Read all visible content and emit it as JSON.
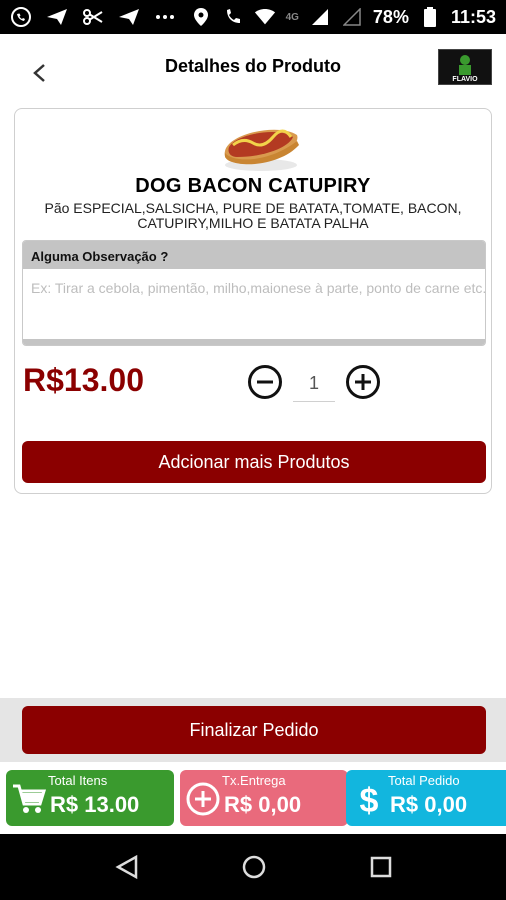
{
  "status_bar": {
    "network": "4G",
    "battery": "78%",
    "time": "11:53"
  },
  "header": {
    "title": "Detalhes do Produto",
    "logo_text": "FLAVIO"
  },
  "product": {
    "name": "DOG BACON CATUPIRY",
    "description": "Pão ESPECIAL,SALSICHA, PURE DE BATATA,TOMATE, BACON, CATUPIRY,MILHO E BATATA PALHA",
    "price": "R$13.00"
  },
  "observation": {
    "label": "Alguma Observação ?",
    "placeholder": "Ex: Tirar a cebola, pimentão, milho,maionese à parte, ponto de carne etc."
  },
  "quantity": {
    "value": "1"
  },
  "buttons": {
    "add_more": "Adcionar mais Produtos",
    "finalize": "Finalizar Pedido"
  },
  "totals": {
    "items_label": "Total Itens",
    "items_value": "R$ 13.00",
    "fee_label": "Tx.Entrega",
    "fee_value": "R$ 0,00",
    "order_label": "Total Pedido",
    "order_value": "R$ 0,00"
  },
  "colors": {
    "brand": "#8b0000",
    "items_green": "#3a9a2e",
    "fee_pink": "#e96a7c",
    "order_cyan": "#12b6de"
  },
  "icons": [
    "whatsapp-icon",
    "send-icon",
    "scissors-icon",
    "send-icon",
    "more-icon",
    "location-icon",
    "phone-4g-icon",
    "wifi-icon",
    "signal-icon",
    "battery-icon",
    "back-arrow-icon",
    "hotdog-image",
    "minus-circle-icon",
    "plus-circle-icon",
    "cart-icon",
    "plus-circle-icon",
    "dollar-icon",
    "nav-back-icon",
    "nav-home-icon",
    "nav-recents-icon"
  ]
}
